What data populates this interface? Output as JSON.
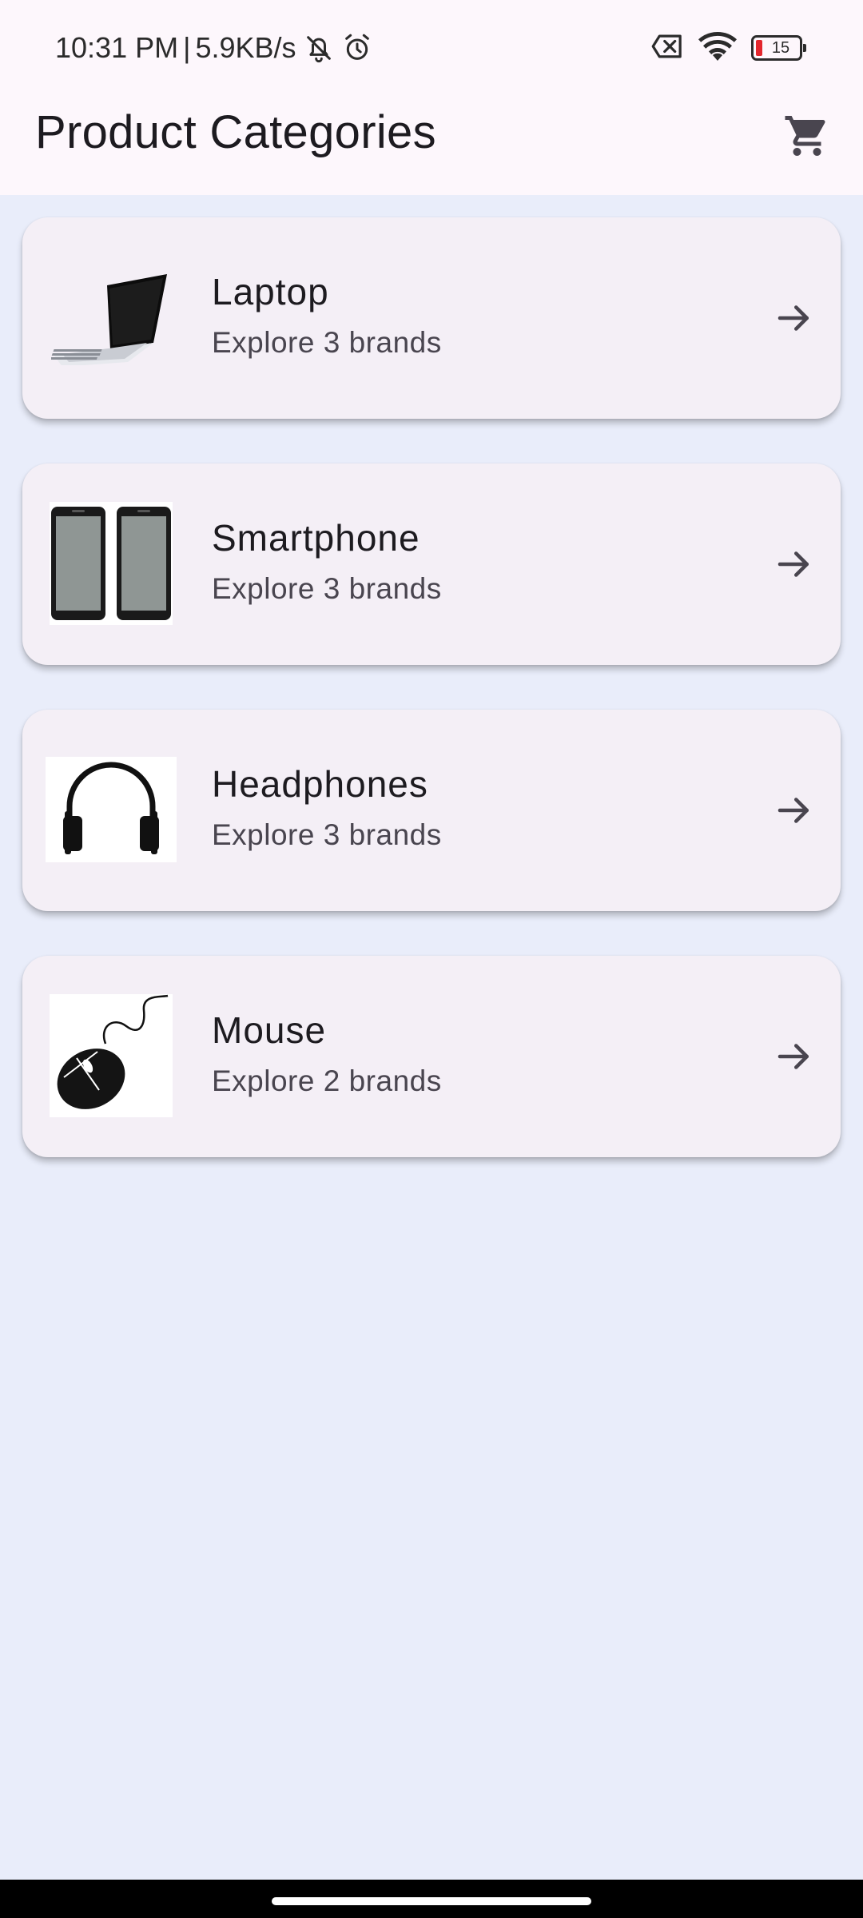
{
  "status_bar": {
    "time": "10:31 PM",
    "separator": "|",
    "net_speed": "5.9KB/s",
    "battery_percent": "15",
    "battery_level": 0.15,
    "icons": [
      "bell-off-icon",
      "alarm-icon",
      "sim-x-icon",
      "wifi-icon",
      "battery-icon"
    ],
    "battery_color": "#e3262d"
  },
  "app_bar": {
    "title": "Product Categories",
    "cart_icon": "shopping-cart-icon"
  },
  "categories": [
    {
      "name": "Laptop",
      "subtitle": "Explore 3 brands",
      "image": "laptop-image",
      "icon": "arrow-forward-icon"
    },
    {
      "name": "Smartphone",
      "subtitle": "Explore 3 brands",
      "image": "smartphone-image",
      "icon": "arrow-forward-icon"
    },
    {
      "name": "Headphones",
      "subtitle": "Explore 3 brands",
      "image": "headphones-image",
      "icon": "arrow-forward-icon"
    },
    {
      "name": "Mouse",
      "subtitle": "Explore 2 brands",
      "image": "mouse-image",
      "icon": "arrow-forward-icon"
    }
  ],
  "colors": {
    "background": "#e9edfa",
    "app_bar": "#fdf7fc",
    "card": "#f4eff6",
    "text_primary": "#1d1b20",
    "text_secondary": "#49454f"
  }
}
